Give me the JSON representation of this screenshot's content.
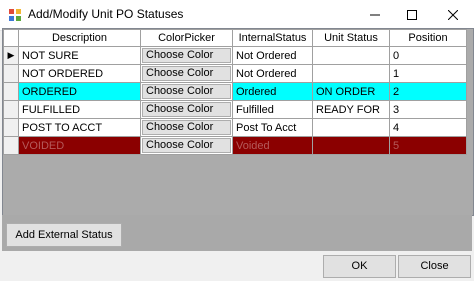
{
  "window": {
    "title": "Add/Modify Unit PO Statuses"
  },
  "grid": {
    "columns": [
      "Description",
      "ColorPicker",
      "InternalStatus",
      "Unit Status",
      "Position"
    ],
    "rows": [
      {
        "description": "NOT SURE",
        "color_picker": "Choose Color",
        "internal_status": "Not Ordered",
        "unit_status": "",
        "position": "0",
        "current": true
      },
      {
        "description": "NOT ORDERED",
        "color_picker": "Choose Color",
        "internal_status": "Not Ordered",
        "unit_status": "",
        "position": "1"
      },
      {
        "description": "ORDERED",
        "color_picker": "Choose Color",
        "internal_status": "Ordered",
        "unit_status": "ON ORDER",
        "position": "2",
        "row_color": "#00ffff"
      },
      {
        "description": "FULFILLED",
        "color_picker": "Choose Color",
        "internal_status": "Fulfilled",
        "unit_status": "READY FOR",
        "position": "3"
      },
      {
        "description": "POST TO ACCT",
        "color_picker": "Choose Color",
        "internal_status": "Post To Acct",
        "unit_status": "",
        "position": "4"
      },
      {
        "description": "VOIDED",
        "color_picker": "Choose Color",
        "internal_status": "Voided",
        "unit_status": "",
        "position": "5",
        "row_color": "#8b0000"
      }
    ]
  },
  "buttons": {
    "add_external": "Add External Status",
    "ok": "OK",
    "close": "Close"
  },
  "icons": {
    "app": "app-icon",
    "minimize": "minimize-icon",
    "maximize": "maximize-icon",
    "close": "close-icon",
    "current_row": "current-row-arrow-icon"
  }
}
